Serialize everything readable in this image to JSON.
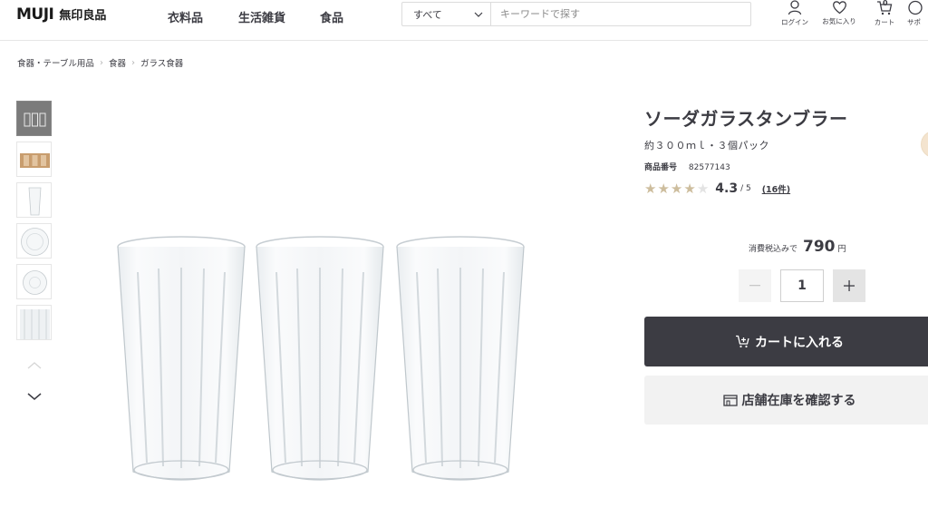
{
  "brand": {
    "name_en": "MUJI",
    "name_jp": "無印良品"
  },
  "nav": [
    {
      "label": "衣料品"
    },
    {
      "label": "生活雑貨"
    },
    {
      "label": "食品"
    }
  ],
  "search": {
    "category": "すべて",
    "placeholder": "キーワードで探す"
  },
  "utility": {
    "login": "ログイン",
    "favorites": "お気に入り",
    "cart": "カート",
    "cart_count": "0",
    "support": "サポ"
  },
  "breadcrumb": [
    "食器・テーブル用品",
    "食器",
    "ガラス食器"
  ],
  "product": {
    "title": "ソーダガラスタンブラー",
    "subtitle": "約３００ｍｌ・３個パック",
    "code_label": "商品番号",
    "code": "82577143",
    "rating": 4.3,
    "rating_value": "4.3",
    "rating_max": "/ 5",
    "review_count": "(16件)",
    "tax_label": "消費税込みで",
    "price": "790",
    "currency": "円",
    "quantity": "1"
  },
  "actions": {
    "add_to_cart": "カートに入れる",
    "check_store": "店舗在庫を確認する"
  },
  "colors": {
    "primary": "#3c3c43",
    "star_filled": "#cdbd9d",
    "star_empty": "#e3e3e3",
    "secondary_bg": "#f2f2f2"
  },
  "icons": [
    "user-icon",
    "heart-icon",
    "cart-icon",
    "chevron-down-icon",
    "chevron-up-icon",
    "store-icon"
  ]
}
